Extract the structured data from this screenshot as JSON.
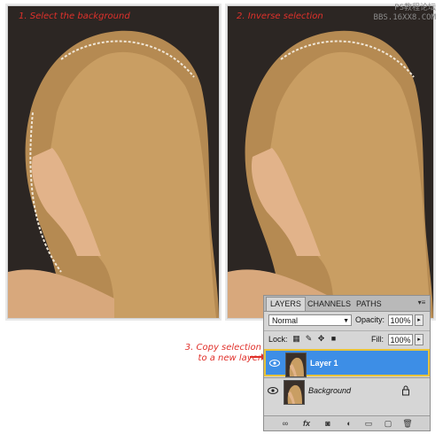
{
  "steps": {
    "step1": "1. Select the background",
    "step2": "2. Inverse selection",
    "step3_line1": "3. Copy selection",
    "step3_line2": "to a new layer"
  },
  "watermark": {
    "line1": "PS教程论坛",
    "line2": "BBS.16XX8.COM"
  },
  "layers_panel": {
    "tabs": [
      "LAYERS",
      "CHANNELS",
      "PATHS"
    ],
    "active_tab": "LAYERS",
    "blend_mode": "Normal",
    "opacity_label": "Opacity:",
    "opacity_value": "100%",
    "lock_label": "Lock:",
    "fill_label": "Fill:",
    "fill_value": "100%",
    "layers": [
      {
        "name": "Layer 1",
        "selected": true
      },
      {
        "name": "Background",
        "selected": false,
        "locked": true
      }
    ],
    "footer_icons": [
      "link-icon",
      "fx-icon",
      "mask-icon",
      "adjustment-icon",
      "group-folder-icon",
      "new-layer-icon",
      "trash-icon"
    ]
  },
  "colors": {
    "step_text": "#e0312b",
    "selection_blue": "#3d8ee6",
    "selection_border": "#e8c33a"
  }
}
